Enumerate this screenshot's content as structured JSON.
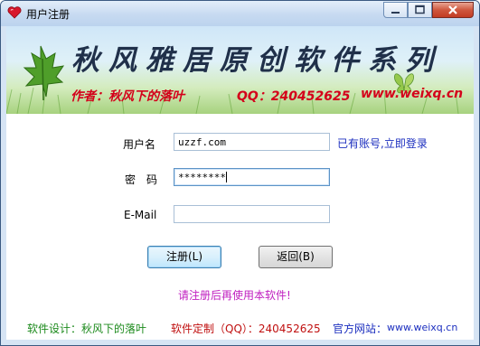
{
  "window": {
    "title": "用户注册"
  },
  "banner": {
    "title": "秋风雅居原创软件系列",
    "author": "作者：秋风下的落叶",
    "qq": "QQ：240452625",
    "site": "www.weixq.cn"
  },
  "form": {
    "username_label": "用户名",
    "username_value": "uzzf.com",
    "login_link": "已有账号,立即登录",
    "password_label": "密　码",
    "password_value": "********",
    "email_label": "E-Mail",
    "email_value": ""
  },
  "buttons": {
    "register": "注册(L)",
    "back": "返回(B)"
  },
  "notice": "请注册后再使用本软件!",
  "footer": {
    "design": "软件设计：秋风下的落叶",
    "custom": "软件定制（QQ）：240452625",
    "site_label": "官方网站：",
    "site_url": "www.weixq.cn"
  },
  "colors": {
    "banner_text": "#d4001a",
    "notice": "#c020c0",
    "link": "#1b2ebf",
    "footer_green": "#1c8a1c",
    "footer_red": "#c01010",
    "footer_blue": "#1b2ebf"
  }
}
